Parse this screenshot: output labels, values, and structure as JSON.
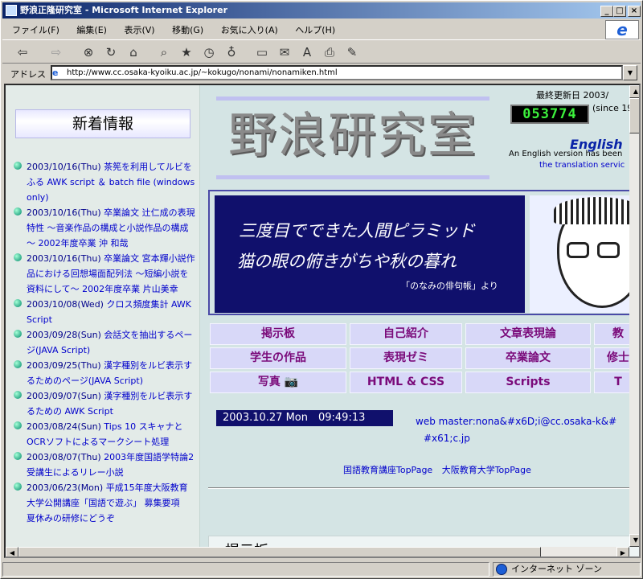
{
  "window": {
    "title": "野浪正隆研究室 - Microsoft Internet Explorer",
    "min_label": "_",
    "max_label": "□",
    "close_label": "×"
  },
  "menu": [
    "ファイル(F)",
    "編集(E)",
    "表示(V)",
    "移動(G)",
    "お気に入り(A)",
    "ヘルプ(H)"
  ],
  "toolbar": {
    "back_label": "⇦",
    "forward_label": "⇨",
    "icons": [
      "back-icon",
      "forward-icon",
      "stop-icon",
      "refresh-icon",
      "home-icon",
      "search-icon",
      "favorites-icon",
      "history-icon",
      "channels-icon",
      "fullscreen-icon",
      "mail-icon",
      "font-icon",
      "print-icon",
      "edit-icon"
    ]
  },
  "address": {
    "label": "アドレス",
    "url": "http://www.cc.osaka-kyoiku.ac.jp/~kokugo/nonami/nonamiken.html"
  },
  "sidebar": {
    "heading": "新着情報",
    "items": [
      {
        "date": "2003/10/16(Thu)",
        "text": "茶筅を利用してルビをふる AWK script ＆ batch file (windows only)"
      },
      {
        "date": "2003/10/16(Thu)",
        "text": "卒業論文 辻仁成の表現特性 ～音楽作品の構成と小説作品の構成～ 2002年度卒業 沖 和哉"
      },
      {
        "date": "2003/10/16(Thu)",
        "text": "卒業論文 宮本輝小説作品における回想場面配列法 ～短編小説を資料にして～ 2002年度卒業 片山美幸"
      },
      {
        "date": "2003/10/08(Wed)",
        "text": "クロス頻度集計 AWK Script"
      },
      {
        "date": "2003/09/28(Sun)",
        "text": "会話文を抽出するページ(JAVA Script)"
      },
      {
        "date": "2003/09/25(Thu)",
        "text": "漢字種別をルビ表示するためのページ(JAVA Script)"
      },
      {
        "date": "2003/09/07(Sun)",
        "text": "漢字種別をルビ表示するための AWK Script"
      },
      {
        "date": "2003/08/24(Sun)",
        "text": "Tips 10 スキャナとOCRソフトによるマークシート処理"
      },
      {
        "date": "2003/08/07(Thu)",
        "text": "2003年度国語学特論2受講生によるリレー小説"
      },
      {
        "date": "2003/06/23(Mon)",
        "text": "平成15年度大阪教育大学公開講座「国語で遊ぶ」 募集要項　夏休みの研修にどうぞ"
      }
    ]
  },
  "main": {
    "last_updated_label": "最終更新日 2003/",
    "counter": "053774",
    "since": "(since 19",
    "title": "野浪研究室",
    "english_link": "English",
    "english_note": "An English version has been",
    "english_note2": "the translation servic",
    "haiku_line1": "三度目でできた人間ピラミッド",
    "haiku_line2": "猫の眼の俯きがちや秋の暮れ",
    "haiku_source": "「のなみの俳句帳」より",
    "nav": [
      [
        "掲示板",
        "自己紹介",
        "文章表現論",
        "教"
      ],
      [
        "学生の作品",
        "表現ゼミ",
        "卒業論文",
        "修士"
      ],
      [
        "写真 📷",
        "HTML & CSS",
        "Scripts",
        "T"
      ]
    ],
    "clock": "2003.10.27 Mon　09:49:13",
    "webmaster_line1": "web master:nona&#x6D;i@cc.osaka-k&#",
    "webmaster_line2": "#x61;c.jp",
    "link_kokugo": "国語教育講座TopPage",
    "link_osaka": "大阪教育大学TopPage",
    "board_heading": "掲示板"
  },
  "status": {
    "zone": "インターネット ゾーン"
  },
  "colors": {
    "title_bar": "#0a246a",
    "haiku_bg": "#10106c",
    "nav_text": "#7a0a7a",
    "link": "#0000cc"
  }
}
